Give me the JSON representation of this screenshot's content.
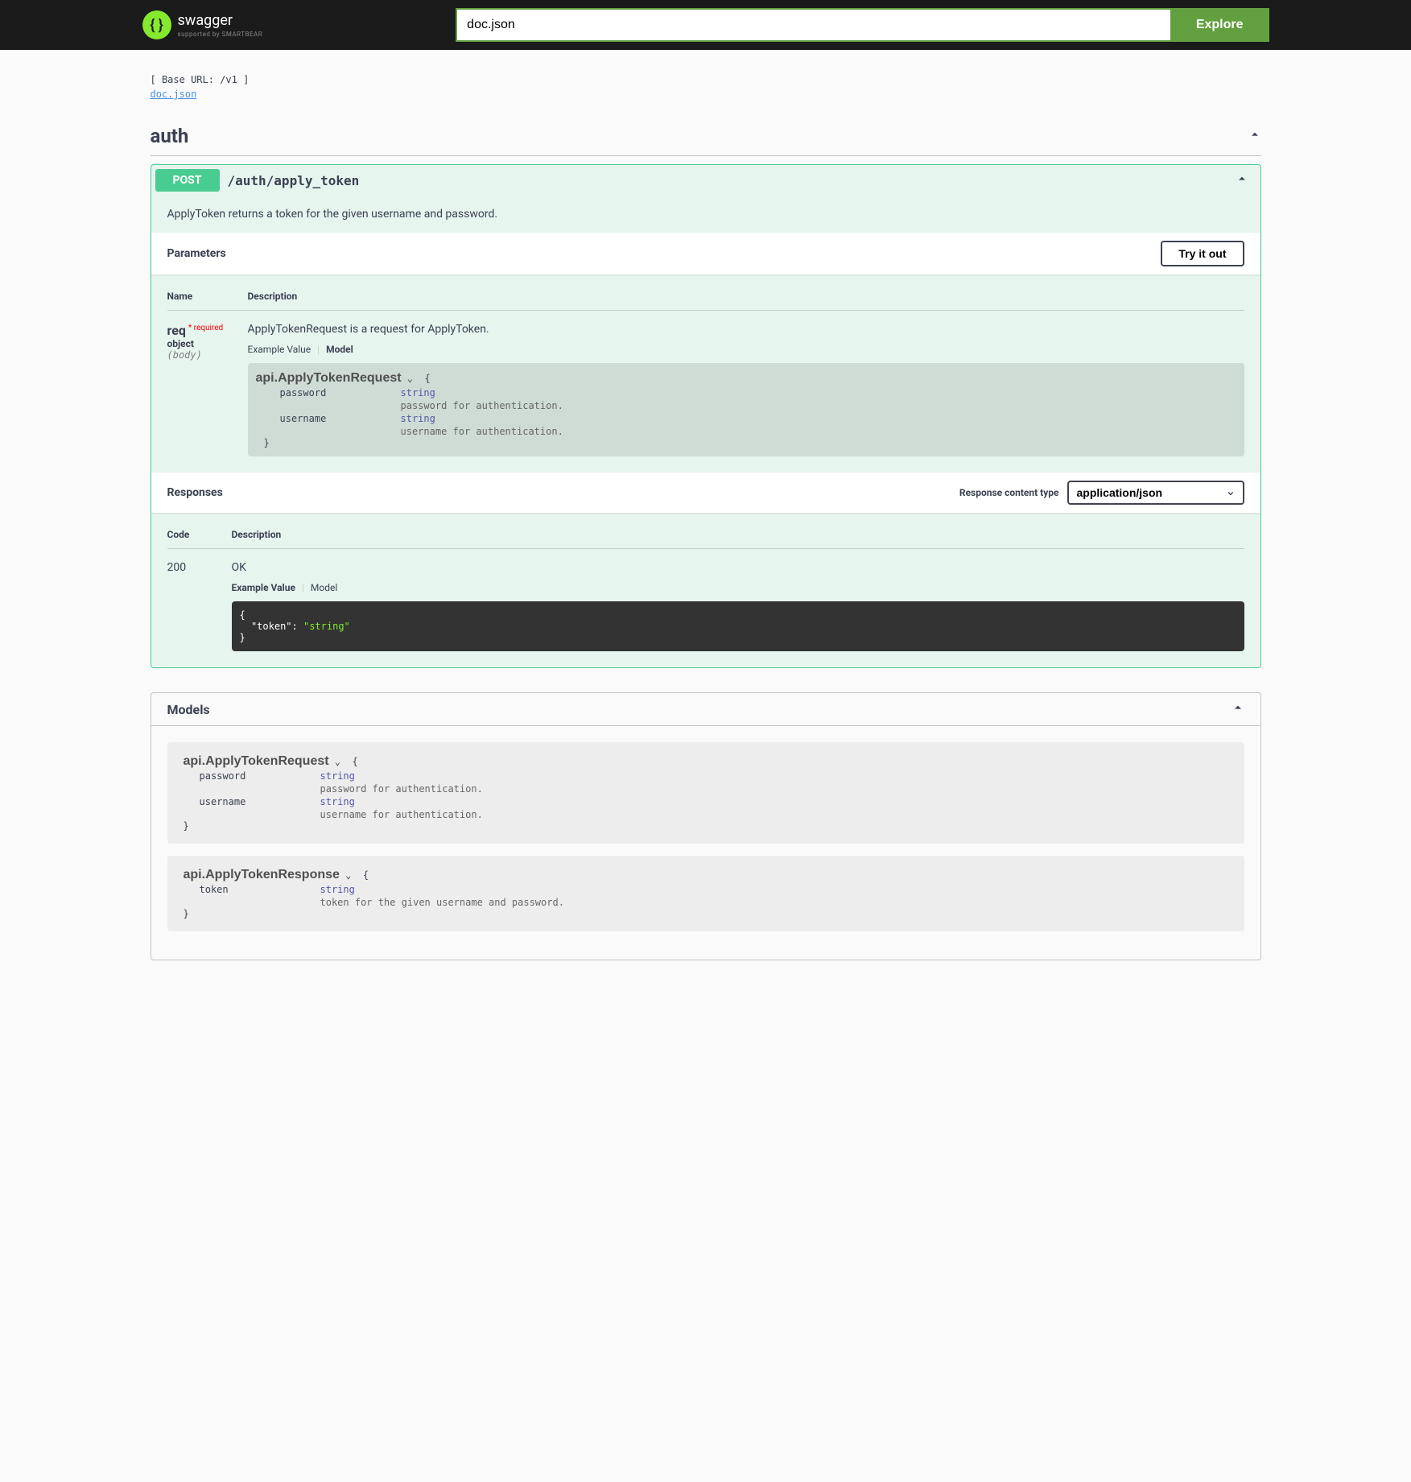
{
  "topbar": {
    "logo_text": "swagger",
    "logo_sub": "supported by SMARTBEAR",
    "search_value": "doc.json",
    "explore_label": "Explore"
  },
  "info": {
    "base_url": "[ Base URL: /v1 ]",
    "doc_link": "doc.json"
  },
  "tag": {
    "name": "auth"
  },
  "operation": {
    "method": "POST",
    "path": "/auth/apply_token",
    "description": "ApplyToken returns a token for the given username and password.",
    "parameters_label": "Parameters",
    "try_it_label": "Try it out",
    "col_name": "Name",
    "col_desc": "Description",
    "param": {
      "name": "req",
      "required_label": "required",
      "type": "object",
      "in": "(body)",
      "description": "ApplyTokenRequest is a request for ApplyToken."
    },
    "tabs": {
      "example": "Example Value",
      "model": "Model"
    },
    "model": {
      "name": "api.ApplyTokenRequest",
      "password_name": "password",
      "password_type": "string",
      "password_desc": "password for authentication.",
      "username_name": "username",
      "username_type": "string",
      "username_desc": "username for authentication."
    },
    "responses_label": "Responses",
    "response_content_type_label": "Response content type",
    "response_content_type": "application/json",
    "resp_code_label": "Code",
    "resp_desc_label": "Description",
    "response": {
      "code": "200",
      "description": "OK",
      "example_key": "\"token\"",
      "example_val": "\"string\""
    }
  },
  "models": {
    "title": "Models",
    "request": {
      "name": "api.ApplyTokenRequest",
      "password_name": "password",
      "password_type": "string",
      "password_desc": "password for authentication.",
      "username_name": "username",
      "username_type": "string",
      "username_desc": "username for authentication."
    },
    "response": {
      "name": "api.ApplyTokenResponse",
      "token_name": "token",
      "token_type": "string",
      "token_desc": "token for the given username and password."
    }
  }
}
